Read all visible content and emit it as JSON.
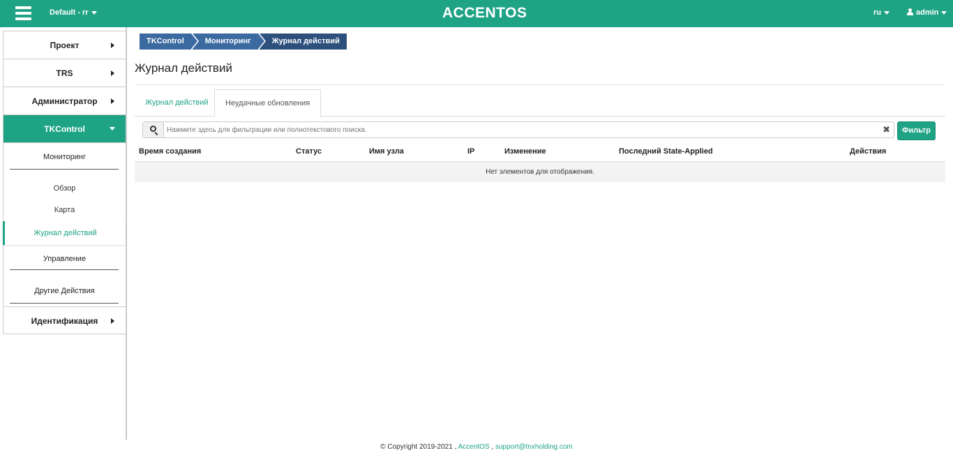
{
  "topbar": {
    "project_selector": "Default - rr",
    "logo": "ACCENTOS",
    "lang": "ru",
    "user": "admin"
  },
  "sidebar": {
    "items": [
      {
        "label": "Проект"
      },
      {
        "label": "TRS"
      },
      {
        "label": "Администратор"
      },
      {
        "label": "TKControl"
      },
      {
        "label": "Идентификация"
      }
    ],
    "tkcontrol": {
      "group_monitoring": "Мониторинг",
      "links": [
        "Обзор",
        "Карта",
        "Журнал действий"
      ],
      "group_management": "Управление",
      "group_other": "Другие Действия"
    }
  },
  "breadcrumb": [
    "TKControl",
    "Мониторинг",
    "Журнал действий"
  ],
  "page_title": "Журнал действий",
  "tabs": [
    "Журнал действий",
    "Неудачные обновления"
  ],
  "search": {
    "placeholder": "Нажмите здесь для фильтрации или полнотекстового поиска.",
    "clear_symbol": "✖"
  },
  "filter_button": "Фильтр",
  "table": {
    "columns": [
      "Время создания",
      "Статус",
      "Имя узла",
      "IP",
      "Изменение",
      "Последний State-Applied",
      "Действия"
    ],
    "empty_message": "Нет элементов для отображения."
  },
  "footer": {
    "copyright": "© Copyright 2019-2021 ,",
    "brand": "AccentOS",
    "separator": ",",
    "email": "support@tnxholding.com"
  },
  "colors": {
    "accent": "#1fa385",
    "breadcrumb": "#3b6aa0",
    "breadcrumb_active": "#2c4f7c"
  }
}
